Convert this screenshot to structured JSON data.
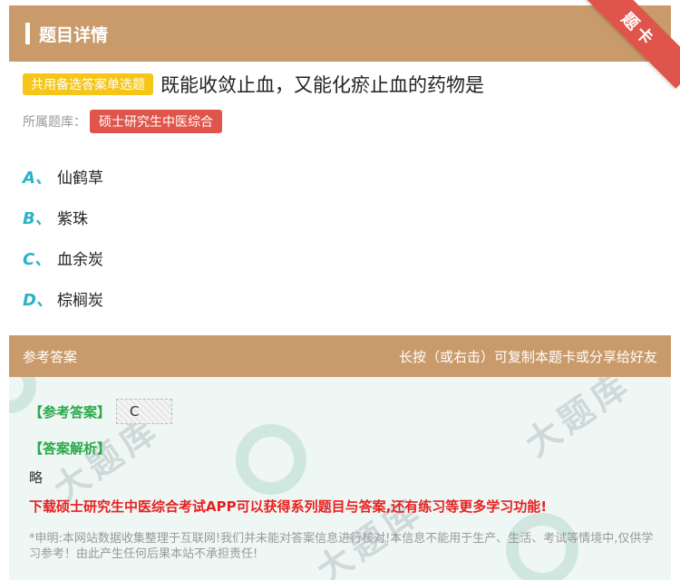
{
  "header": {
    "title": "题目详情",
    "corner_label": "题卡"
  },
  "question": {
    "type_badge": "共用备选答案单选题",
    "text": "既能收敛止血，又能化瘀止血的药物是",
    "library_label": "所属题库：",
    "library_name": "硕士研究生中医综合"
  },
  "options": [
    {
      "letter": "A、",
      "text": "仙鹤草"
    },
    {
      "letter": "B、",
      "text": "紫珠"
    },
    {
      "letter": "C、",
      "text": "血余炭"
    },
    {
      "letter": "D、",
      "text": "棕榈炭"
    }
  ],
  "answer_bar": {
    "left": "参考答案",
    "right": "长按（或右击）可复制本题卡或分享给好友"
  },
  "answer": {
    "ref_label": "【参考答案】",
    "ref_value": "C",
    "analysis_label": "【答案解析】",
    "analysis_text": "略",
    "promo": "下载硕士研究生中医综合考试APP可以获得系列题目与答案,还有练习等更多学习功能!",
    "disclaimer": "*申明:本网站数据收集整理于互联网!我们并未能对答案信息进行核对!本信息不能用于生产、生活、考试等情境中,仅供学习参考！由此产生任何后果本站不承担责任!"
  },
  "colors": {
    "header_bg": "#c99b6b",
    "badge_yellow": "#f5c518",
    "tag_red": "#e0554b",
    "option_letter": "#2bb3c7",
    "answer_green": "#2aa84a",
    "promo_red": "#e82020",
    "panel_bg": "#eef7f4"
  }
}
